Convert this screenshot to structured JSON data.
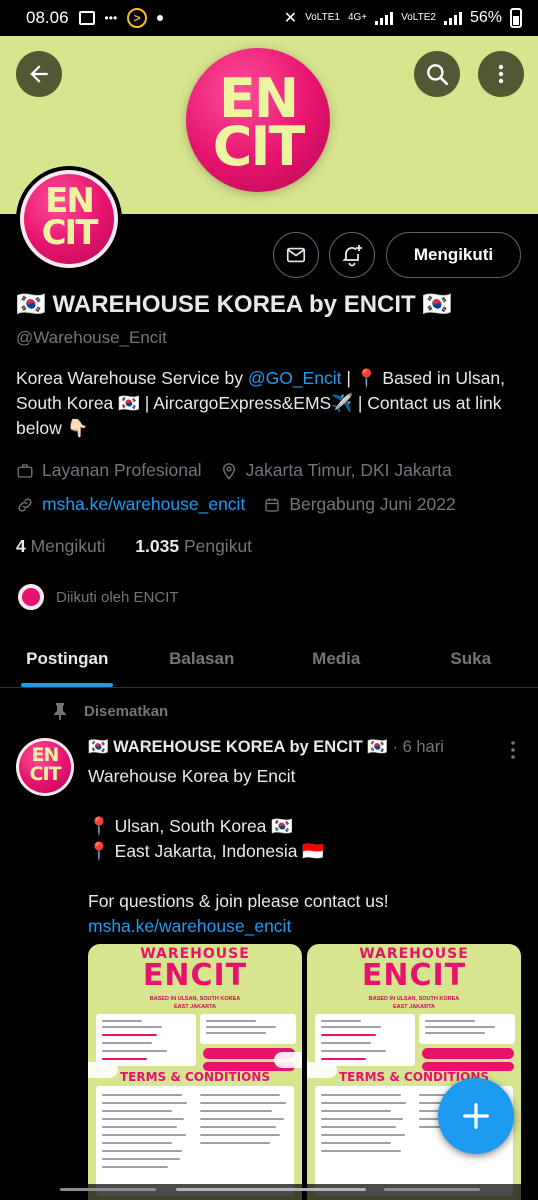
{
  "status_bar": {
    "time": "08.06",
    "network_1": "VoLTE1",
    "network_2": "4G+",
    "network_3": "VoLTE2",
    "battery": "56%"
  },
  "banner": {
    "logo_line1": "EN",
    "logo_line2": "CIT",
    "background_color": "#d8e58f",
    "logo_color": "#e5136d"
  },
  "header_buttons": {
    "back_icon": "arrow-left-icon",
    "search_icon": "search-icon",
    "more_icon": "more-vertical-icon"
  },
  "profile": {
    "avatar_line1": "EN",
    "avatar_line2": "CIT",
    "follow_button": "Mengikuti",
    "name": "🇰🇷 WAREHOUSE KOREA by ENCIT 🇰🇷",
    "handle": "@Warehouse_Encit",
    "bio": {
      "prefix": "Korea Warehouse Service by ",
      "mention": "@GO_Encit",
      "suffix": " | 📍 Based in Ulsan, South Korea 🇰🇷 | AircargoExpress&EMS✈️ | Contact us at link below 👇🏻"
    },
    "category": "Layanan Profesional",
    "location": "Jakarta Timur, DKI Jakarta",
    "website": "msha.ke/warehouse_encit",
    "joined": "Bergabung Juni 2022",
    "following_count": "4",
    "following_label": "Mengikuti",
    "followers_count": "1.035",
    "followers_label": "Pengikut",
    "followed_by": "Diikuti oleh ENCIT"
  },
  "tabs": [
    {
      "label": "Postingan",
      "active": true
    },
    {
      "label": "Balasan",
      "active": false
    },
    {
      "label": "Media",
      "active": false
    },
    {
      "label": "Suka",
      "active": false
    }
  ],
  "pinned_post": {
    "pinned_label": "Disematkan",
    "author": "🇰🇷 WAREHOUSE KOREA by ENCIT 🇰🇷",
    "separator": "·",
    "time": "6 hari",
    "line1": "Warehouse Korea by Encit",
    "line2": "📍 Ulsan, South Korea 🇰🇷",
    "line3": "📍 East Jakarta, Indonesia 🇮🇩",
    "line4": "For questions & join please contact us!",
    "link": "msha.ke/warehouse_encit",
    "media": [
      {
        "title_top": "WAREHOUSE",
        "title_main": "ENCIT",
        "subtitle1": "BASED IN ULSAN, SOUTH KOREA",
        "subtitle2": "EAST JAKARTA",
        "section": "TERMS & CONDITIONS"
      },
      {
        "title_top": "WAREHOUSE",
        "title_main": "ENCIT",
        "subtitle1": "BASED IN ULSAN, SOUTH KOREA",
        "subtitle2": "EAST JAKARTA",
        "section": "TERMS & CONDITIONS"
      }
    ]
  },
  "fab": {
    "icon": "plus-icon",
    "color": "#1d9bf0"
  },
  "colors": {
    "accent": "#1d9bf0",
    "muted": "#71767b",
    "text": "#e7e9ea"
  }
}
